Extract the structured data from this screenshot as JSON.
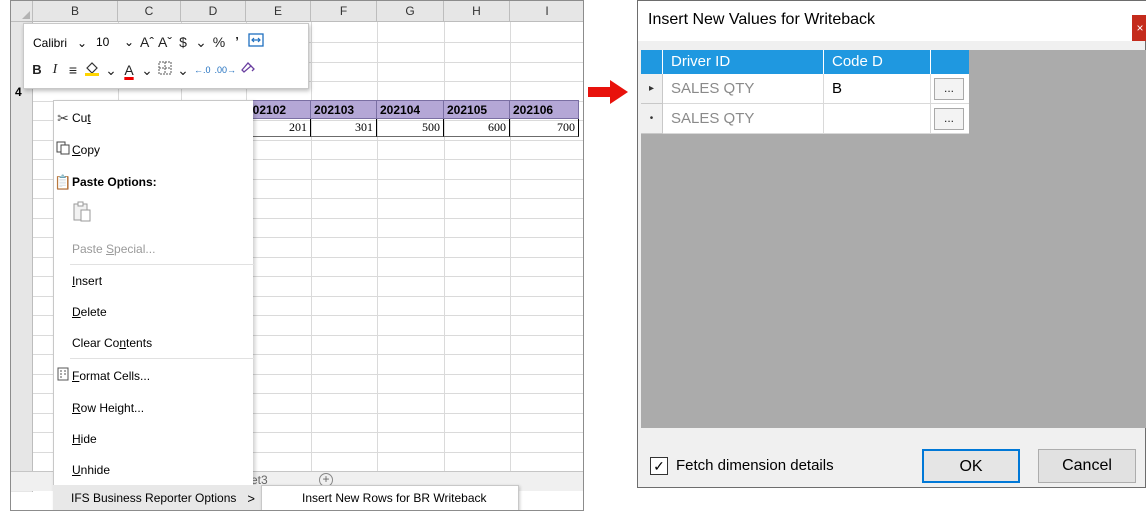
{
  "excel": {
    "columns": [
      "B",
      "C",
      "D",
      "E",
      "F",
      "G",
      "H",
      "I"
    ],
    "row_label": "4",
    "months": [
      "202102",
      "202103",
      "202104",
      "202105",
      "202106"
    ],
    "values": [
      "201",
      "301",
      "500",
      "600",
      "700"
    ],
    "sheet_tab_partial": "et3",
    "add_sheet": "+"
  },
  "mini_toolbar": {
    "font": "Calibri",
    "size": "10",
    "grow_font": "Aˆ",
    "shrink_font": "Aˇ",
    "currency": "$",
    "percent": "%",
    "comma": "’",
    "bold": "B",
    "italic": "I",
    "align": "≡",
    "font_color": "A",
    "dec_inc": "←.0",
    "dec_dec": ".00→"
  },
  "context_menu": {
    "cut": {
      "pre": "Cu",
      "ul": "t",
      "post": ""
    },
    "copy": {
      "pre": "",
      "ul": "C",
      "post": "opy"
    },
    "paste_options": "Paste Options:",
    "paste_special": {
      "pre": "Paste ",
      "ul": "S",
      "post": "pecial..."
    },
    "insert": {
      "pre": "",
      "ul": "I",
      "post": "nsert"
    },
    "delete": {
      "pre": "",
      "ul": "D",
      "post": "elete"
    },
    "clear_contents": {
      "pre": "Clear Co",
      "ul": "n",
      "post": "tents"
    },
    "format_cells": {
      "pre": "",
      "ul": "F",
      "post": "ormat Cells..."
    },
    "row_height": {
      "pre": "",
      "ul": "R",
      "post": "ow Height..."
    },
    "hide": {
      "pre": "",
      "ul": "H",
      "post": "ide"
    },
    "unhide": {
      "pre": "",
      "ul": "U",
      "post": "nhide"
    },
    "ifs_options": "IFS Business Reporter Options",
    "ifs_chevron": ">",
    "submenu_item": "Insert New Rows for BR Writeback"
  },
  "dialog": {
    "title": "Insert New Values for Writeback",
    "close": "×",
    "headers": [
      "Driver ID",
      "Code D",
      ""
    ],
    "rows": [
      {
        "indicator": "▸",
        "driver_id": "SALES QTY",
        "code_d": "B",
        "button": "..."
      },
      {
        "indicator": "•",
        "driver_id": "SALES QTY",
        "code_d": "",
        "button": "..."
      }
    ],
    "fetch_label": "Fetch dimension details",
    "fetch_checked": "✓",
    "ok": "OK",
    "cancel": "Cancel"
  },
  "colors": {
    "header_blue": "#1f98e0",
    "month_fill": "#b4a7d6",
    "arrow_red": "#e8120c",
    "close_red": "#c42b1c",
    "grid_gray": "#ababab"
  }
}
